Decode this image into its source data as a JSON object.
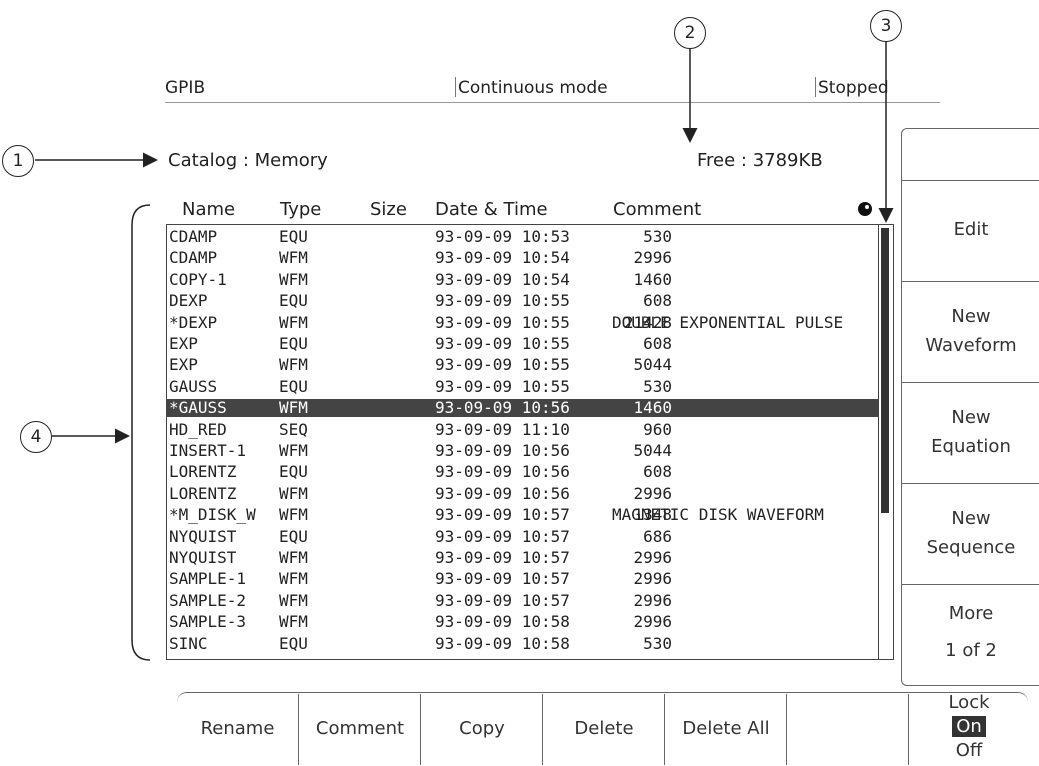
{
  "status": {
    "interface": "GPIB",
    "mode": "Continuous mode",
    "state": "Stopped"
  },
  "catalog_label": "Catalog : Memory",
  "free_label": "Free : 3789KB",
  "callouts": [
    "1",
    "2",
    "3",
    "4"
  ],
  "columns": {
    "name": "Name",
    "type": "Type",
    "size": "Size",
    "datetime": "Date & Time",
    "comment": "Comment"
  },
  "rows": [
    {
      "name": "CDAMP",
      "type": "EQU",
      "size": "530",
      "datetime": "93-09-09 10:53",
      "comment": ""
    },
    {
      "name": "CDAMP",
      "type": "WFM",
      "size": "2996",
      "datetime": "93-09-09 10:54",
      "comment": ""
    },
    {
      "name": "COPY-1",
      "type": "WFM",
      "size": "1460",
      "datetime": "93-09-09 10:54",
      "comment": ""
    },
    {
      "name": "DEXP",
      "type": "EQU",
      "size": "608",
      "datetime": "93-09-09 10:55",
      "comment": ""
    },
    {
      "name": "*DEXP",
      "type": "WFM",
      "size": "21428",
      "datetime": "93-09-09 10:55",
      "comment": "DOUBLE EXPONENTIAL PULSE"
    },
    {
      "name": "EXP",
      "type": "EQU",
      "size": "608",
      "datetime": "93-09-09 10:55",
      "comment": ""
    },
    {
      "name": "EXP",
      "type": "WFM",
      "size": "5044",
      "datetime": "93-09-09 10:55",
      "comment": ""
    },
    {
      "name": "GAUSS",
      "type": "EQU",
      "size": "530",
      "datetime": "93-09-09 10:55",
      "comment": ""
    },
    {
      "name": "*GAUSS",
      "type": "WFM",
      "size": "1460",
      "datetime": "93-09-09 10:56",
      "comment": "",
      "selected": true
    },
    {
      "name": "HD_RED",
      "type": "SEQ",
      "size": "960",
      "datetime": "93-09-09 11:10",
      "comment": ""
    },
    {
      "name": "INSERT-1",
      "type": "WFM",
      "size": "5044",
      "datetime": "93-09-09 10:56",
      "comment": ""
    },
    {
      "name": "LORENTZ",
      "type": "EQU",
      "size": "608",
      "datetime": "93-09-09 10:56",
      "comment": ""
    },
    {
      "name": "LORENTZ",
      "type": "WFM",
      "size": "2996",
      "datetime": "93-09-09 10:56",
      "comment": ""
    },
    {
      "name": "*M_DISK_W",
      "type": "WFM",
      "size": "1348",
      "datetime": "93-09-09 10:57",
      "comment": "MAGNETIC DISK WAVEFORM"
    },
    {
      "name": "NYQUIST",
      "type": "EQU",
      "size": "686",
      "datetime": "93-09-09 10:57",
      "comment": ""
    },
    {
      "name": "NYQUIST",
      "type": "WFM",
      "size": "2996",
      "datetime": "93-09-09 10:57",
      "comment": ""
    },
    {
      "name": "SAMPLE-1",
      "type": "WFM",
      "size": "2996",
      "datetime": "93-09-09 10:57",
      "comment": ""
    },
    {
      "name": "SAMPLE-2",
      "type": "WFM",
      "size": "2996",
      "datetime": "93-09-09 10:57",
      "comment": ""
    },
    {
      "name": "SAMPLE-3",
      "type": "WFM",
      "size": "2996",
      "datetime": "93-09-09 10:58",
      "comment": ""
    },
    {
      "name": "SINC",
      "type": "EQU",
      "size": "530",
      "datetime": "93-09-09 10:58",
      "comment": ""
    }
  ],
  "side_menu": {
    "edit": "Edit",
    "new_waveform": [
      "New",
      "Waveform"
    ],
    "new_equation": [
      "New",
      "Equation"
    ],
    "new_sequence": [
      "New",
      "Sequence"
    ],
    "more": [
      "More",
      "1 of 2"
    ]
  },
  "bottom_menu": [
    "Rename",
    "Comment",
    "Copy",
    "Delete",
    "Delete All",
    ""
  ],
  "lock": {
    "label": "Lock",
    "on": "On",
    "off": "Off"
  }
}
